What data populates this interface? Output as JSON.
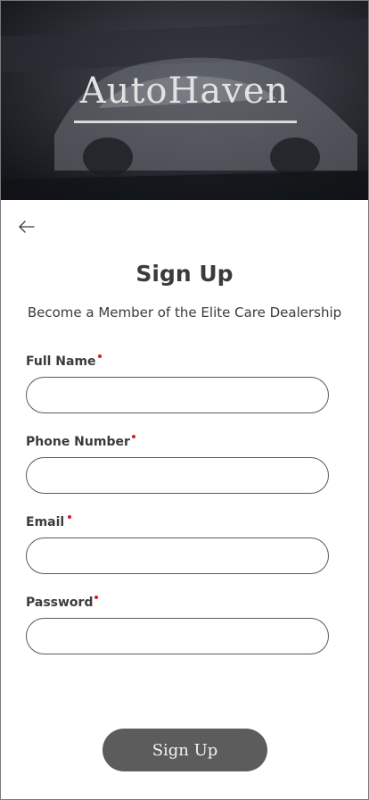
{
  "header": {
    "brand": "AutoHaven"
  },
  "nav": {
    "back_icon": "arrow-left-icon"
  },
  "page": {
    "title": "Sign Up",
    "subtitle": "Become a Member of the Elite Care Dealership"
  },
  "form": {
    "fields": [
      {
        "label": "Full Name",
        "required": true,
        "value": "",
        "placeholder": ""
      },
      {
        "label": "Phone Number",
        "required": true,
        "value": "",
        "placeholder": ""
      },
      {
        "label": "Email",
        "required": true,
        "value": "",
        "placeholder": ""
      },
      {
        "label": "Password",
        "required": true,
        "value": "",
        "placeholder": ""
      }
    ],
    "submit_label": "Sign Up"
  },
  "colors": {
    "required_marker": "#d71920",
    "button_bg": "#5d5c5d",
    "text": "#3b3b3b"
  }
}
